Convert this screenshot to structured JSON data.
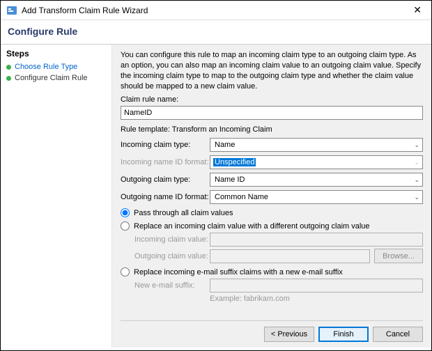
{
  "window": {
    "title": "Add Transform Claim Rule Wizard",
    "header": "Configure Rule"
  },
  "sidebar": {
    "title": "Steps",
    "items": [
      {
        "label": "Choose Rule Type"
      },
      {
        "label": "Configure Claim Rule"
      }
    ]
  },
  "description": "You can configure this rule to map an incoming claim type to an outgoing claim type. As an option, you can also map an incoming claim value to an outgoing claim value. Specify the incoming claim type to map to the outgoing claim type and whether the claim value should be mapped to a new claim value.",
  "fields": {
    "claim_rule_name_label": "Claim rule name:",
    "claim_rule_name_value": "NameID",
    "rule_template_label": "Rule template: Transform an Incoming Claim",
    "incoming_claim_type_label": "Incoming claim type:",
    "incoming_claim_type_value": "Name",
    "incoming_name_id_format_label": "Incoming name ID format:",
    "incoming_name_id_format_value": "Unspecified",
    "outgoing_claim_type_label": "Outgoing claim type:",
    "outgoing_claim_type_value": "Name ID",
    "outgoing_name_id_format_label": "Outgoing name ID format:",
    "outgoing_name_id_format_value": "Common Name"
  },
  "radios": {
    "pass_through": "Pass through all claim values",
    "replace_value": "Replace an incoming claim value with a different outgoing claim value",
    "incoming_claim_value_label": "Incoming claim value:",
    "outgoing_claim_value_label": "Outgoing claim value:",
    "browse_label": "Browse...",
    "replace_suffix": "Replace incoming e-mail suffix claims with a new e-mail suffix",
    "new_email_suffix_label": "New e-mail suffix:",
    "example": "Example: fabrikam.com"
  },
  "buttons": {
    "previous": "< Previous",
    "finish": "Finish",
    "cancel": "Cancel"
  }
}
